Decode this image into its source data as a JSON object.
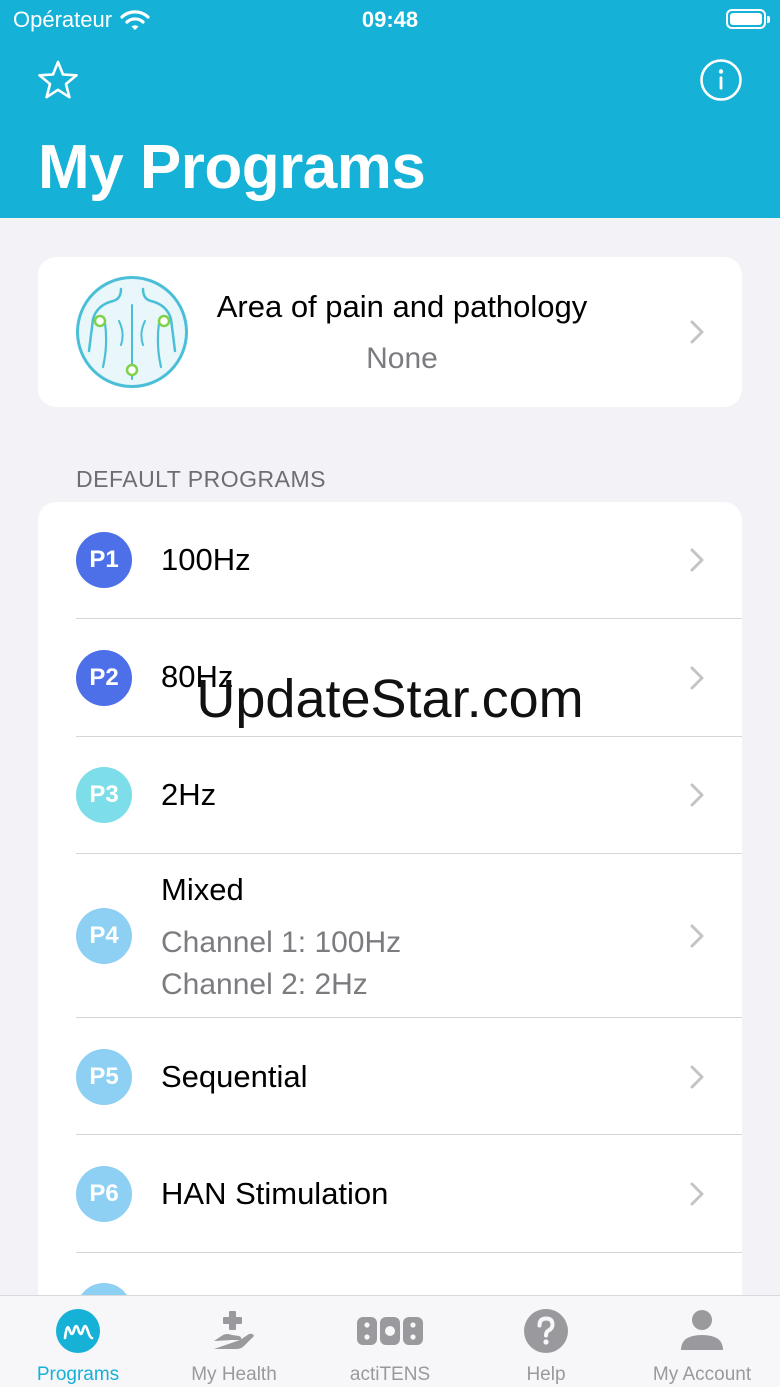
{
  "status_bar": {
    "carrier": "Opérateur",
    "time": "09:48"
  },
  "header": {
    "title": "My Programs"
  },
  "pain_card": {
    "title": "Area of pain and pathology",
    "value": "None"
  },
  "section": {
    "title": "DEFAULT PROGRAMS"
  },
  "programs": [
    {
      "badge": "P1",
      "title": "100Hz",
      "color": "#4d70e8"
    },
    {
      "badge": "P2",
      "title": "80Hz",
      "color": "#4d70e8"
    },
    {
      "badge": "P3",
      "title": "2Hz",
      "color": "#7ddde8"
    },
    {
      "badge": "P4",
      "title": "Mixed",
      "sub1": "Channel 1: 100Hz",
      "sub2": "Channel 2: 2Hz",
      "color": "#8ed0f3"
    },
    {
      "badge": "P5",
      "title": "Sequential",
      "color": "#8ed0f3"
    },
    {
      "badge": "P6",
      "title": "HAN Stimulation",
      "color": "#8ed0f3"
    }
  ],
  "watermark": "UpdateStar.com",
  "tabs": [
    {
      "label": "Programs",
      "icon": "waveform-icon",
      "active": true
    },
    {
      "label": "My Health",
      "icon": "hand-plus-icon"
    },
    {
      "label": "actiTENS",
      "icon": "device-icon"
    },
    {
      "label": "Help",
      "icon": "question-icon"
    },
    {
      "label": "My Account",
      "icon": "person-icon"
    }
  ],
  "colors": {
    "accent": "#16b1d7",
    "background": "#f2f2f7",
    "secondary_text": "#7b7b80"
  }
}
